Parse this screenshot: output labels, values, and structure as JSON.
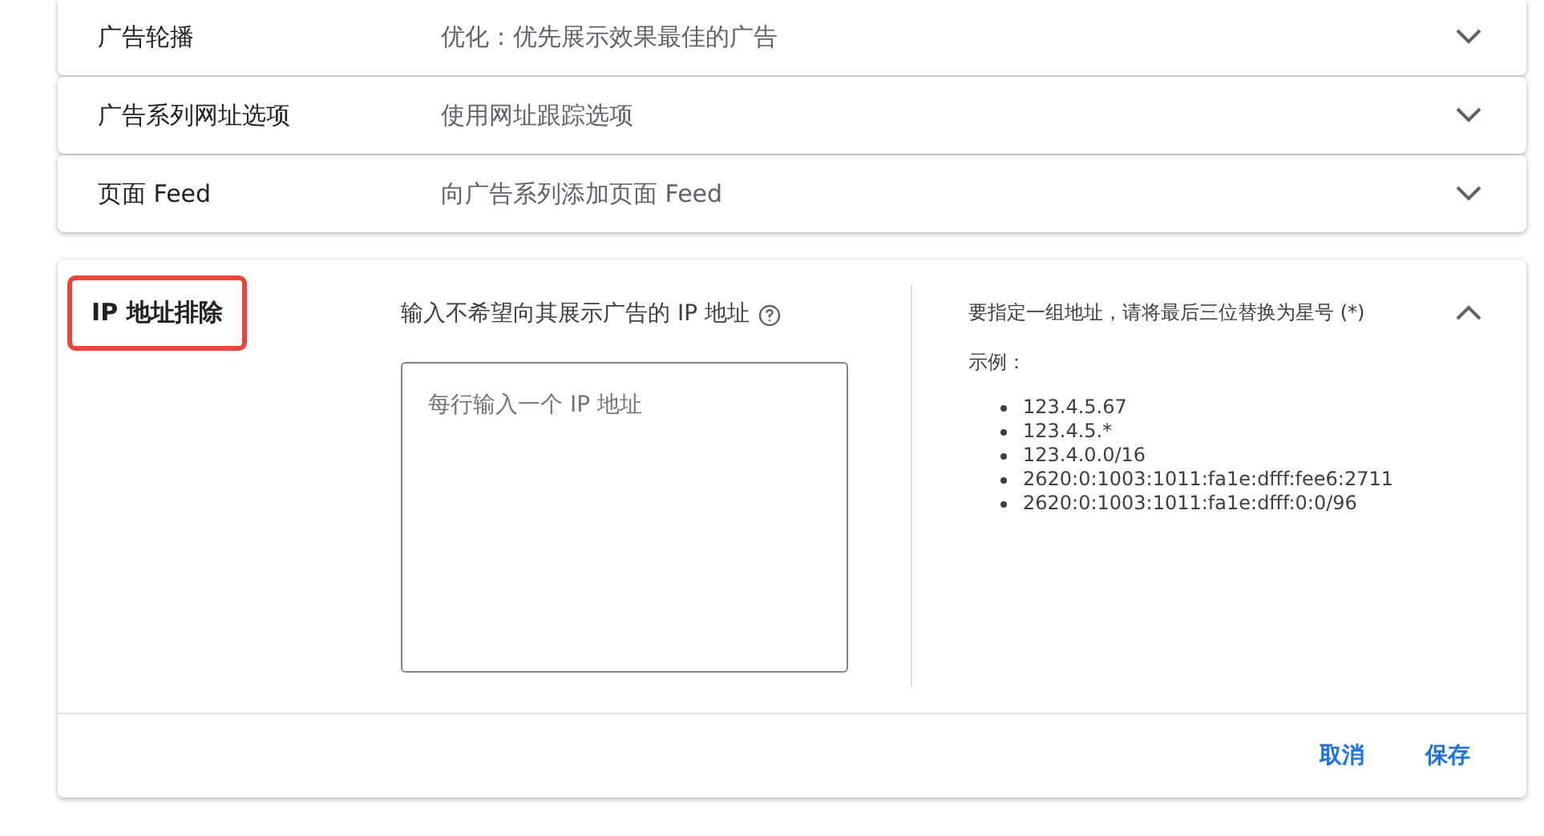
{
  "sections": [
    {
      "title": "广告轮播",
      "summary": "优化：优先展示效果最佳的广告",
      "expanded": false
    },
    {
      "title": "广告系列网址选项",
      "summary": "使用网址跟踪选项",
      "expanded": false
    },
    {
      "title": "页面 Feed",
      "summary": "向广告系列添加页面 Feed",
      "expanded": false
    },
    {
      "title": "IP 地址排除",
      "expanded": true,
      "highlighted": true,
      "field_label": "输入不希望向其展示广告的 IP 地址",
      "placeholder": "每行输入一个 IP 地址",
      "help_text": "要指定一组地址，请将最后三位替换为星号 (*)",
      "examples_label": "示例：",
      "examples": [
        "123.4.5.67",
        "123.4.5.*",
        "123.4.0.0/16",
        "2620:0:1003:1011:fa1e:dfff:fee6:2711",
        "2620:0:1003:1011:fa1e:dfff:0:0/96"
      ],
      "buttons": [
        "取消",
        "保存"
      ]
    }
  ]
}
